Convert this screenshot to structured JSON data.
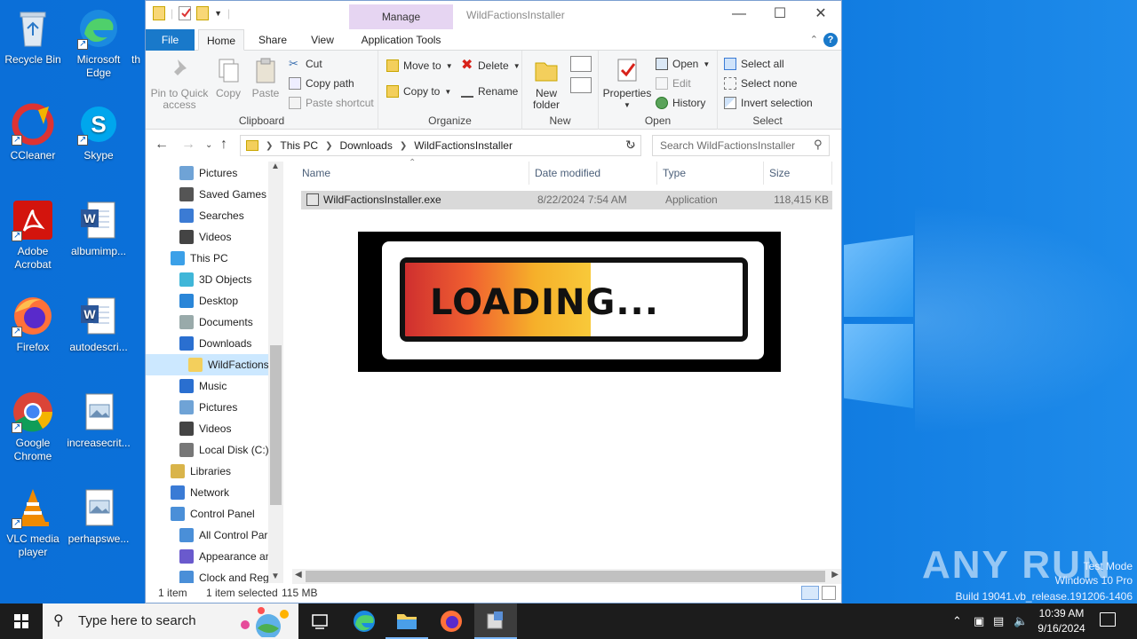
{
  "desktop": {
    "icons": [
      {
        "label": "Recycle Bin"
      },
      {
        "label": "Microsoft Edge"
      },
      {
        "label": "th"
      },
      {
        "label": "CCleaner"
      },
      {
        "label": "Skype"
      },
      {
        "label": "Adobe Acrobat"
      },
      {
        "label": "albumimp..."
      },
      {
        "label": "Firefox"
      },
      {
        "label": "autodescri..."
      },
      {
        "label": "Google Chrome"
      },
      {
        "label": "increasecrit..."
      },
      {
        "label": "VLC media player"
      },
      {
        "label": "perhapswe..."
      }
    ]
  },
  "explorer": {
    "title": "WildFactionsInstaller",
    "manage_tab": "Manage",
    "tabs": {
      "file": "File",
      "home": "Home",
      "share": "Share",
      "view": "View",
      "app_tools": "Application Tools"
    },
    "help": "?",
    "ribbon": {
      "clipboard": {
        "label": "Clipboard",
        "pin": "Pin to Quick access",
        "copy": "Copy",
        "paste": "Paste",
        "cut": "Cut",
        "copy_path": "Copy path",
        "paste_shortcut": "Paste shortcut"
      },
      "organize": {
        "label": "Organize",
        "move_to": "Move to",
        "copy_to": "Copy to",
        "delete": "Delete",
        "rename": "Rename"
      },
      "new": {
        "label": "New",
        "new_folder": "New folder"
      },
      "open": {
        "label": "Open",
        "properties": "Properties",
        "open": "Open",
        "edit": "Edit",
        "history": "History"
      },
      "select": {
        "label": "Select",
        "select_all": "Select all",
        "select_none": "Select none",
        "invert": "Invert selection"
      }
    },
    "address": {
      "crumbs": [
        "This PC",
        "Downloads",
        "WildFactionsInstaller"
      ]
    },
    "search_placeholder": "Search WildFactionsInstaller",
    "nav": [
      {
        "label": "Pictures",
        "icon": "pictures-icon"
      },
      {
        "label": "Saved Games",
        "icon": "saved-games-icon"
      },
      {
        "label": "Searches",
        "icon": "searches-icon"
      },
      {
        "label": "Videos",
        "icon": "videos-icon"
      },
      {
        "label": "This PC",
        "icon": "this-pc-icon"
      },
      {
        "label": "3D Objects",
        "icon": "3d-objects-icon"
      },
      {
        "label": "Desktop",
        "icon": "desktop-icon"
      },
      {
        "label": "Documents",
        "icon": "documents-icon"
      },
      {
        "label": "Downloads",
        "icon": "downloads-icon"
      },
      {
        "label": "WildFactionsI",
        "icon": "folder-icon"
      },
      {
        "label": "Music",
        "icon": "music-icon"
      },
      {
        "label": "Pictures",
        "icon": "pictures-icon"
      },
      {
        "label": "Videos",
        "icon": "videos-icon"
      },
      {
        "label": "Local Disk (C:)",
        "icon": "local-disk-icon"
      },
      {
        "label": "Libraries",
        "icon": "libraries-icon"
      },
      {
        "label": "Network",
        "icon": "network-icon"
      },
      {
        "label": "Control Panel",
        "icon": "control-panel-icon"
      },
      {
        "label": "All Control Par",
        "icon": "control-panel-icon"
      },
      {
        "label": "Appearance an",
        "icon": "appearance-icon"
      },
      {
        "label": "Clock and Regi",
        "icon": "clock-icon"
      }
    ],
    "columns": {
      "name": "Name",
      "date": "Date modified",
      "type": "Type",
      "size": "Size"
    },
    "files": [
      {
        "name": "WildFactionsInstaller.exe",
        "date": "8/22/2024 7:54 AM",
        "type": "Application",
        "size": "118,415 KB"
      }
    ],
    "status": {
      "count": "1 item",
      "selected": "1 item selected",
      "size": "115 MB"
    }
  },
  "overlay": {
    "text": "LOADING...",
    "progress": 0.55
  },
  "taskbar": {
    "search_placeholder": "Type here to search",
    "time": "10:39 AM",
    "date": "9/16/2024"
  },
  "watermark": {
    "brand": "ANY RUN",
    "line1": "Test Mode",
    "line2": "Windows 10 Pro",
    "line3": "Build 19041.vb_release.191206-1406"
  },
  "colors": {
    "accent": "#1979ca",
    "desktop": "#0a74dc",
    "selected_row": "#d9d9d9"
  }
}
